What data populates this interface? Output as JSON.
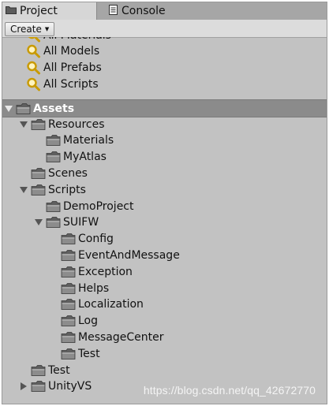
{
  "tabs": [
    {
      "label": "Project",
      "icon": "folder-icon",
      "active": true
    },
    {
      "label": "Console",
      "icon": "console-icon",
      "active": false
    }
  ],
  "toolbar": {
    "create_label": "Create"
  },
  "favorites": [
    {
      "label": "All Materials"
    },
    {
      "label": "All Models"
    },
    {
      "label": "All Prefabs"
    },
    {
      "label": "All Scripts"
    }
  ],
  "tree": [
    {
      "label": "Assets",
      "depth": 0,
      "expander": "open",
      "section": true
    },
    {
      "label": "Resources",
      "depth": 1,
      "expander": "open"
    },
    {
      "label": "Materials",
      "depth": 2,
      "expander": "none"
    },
    {
      "label": "MyAtlas",
      "depth": 2,
      "expander": "none"
    },
    {
      "label": "Scenes",
      "depth": 1,
      "expander": "none"
    },
    {
      "label": "Scripts",
      "depth": 1,
      "expander": "open"
    },
    {
      "label": "DemoProject",
      "depth": 2,
      "expander": "none"
    },
    {
      "label": "SUIFW",
      "depth": 2,
      "expander": "open"
    },
    {
      "label": "Config",
      "depth": 3,
      "expander": "none"
    },
    {
      "label": "EventAndMessage",
      "depth": 3,
      "expander": "none"
    },
    {
      "label": "Exception",
      "depth": 3,
      "expander": "none"
    },
    {
      "label": "Helps",
      "depth": 3,
      "expander": "none"
    },
    {
      "label": "Localization",
      "depth": 3,
      "expander": "none"
    },
    {
      "label": "Log",
      "depth": 3,
      "expander": "none"
    },
    {
      "label": "MessageCenter",
      "depth": 3,
      "expander": "none"
    },
    {
      "label": "Test",
      "depth": 3,
      "expander": "none"
    },
    {
      "label": "Test",
      "depth": 1,
      "expander": "none"
    },
    {
      "label": "UnityVS",
      "depth": 1,
      "expander": "closed"
    }
  ],
  "watermark": "https://blog.csdn.net/qq_42672770",
  "colors": {
    "section_bg": "#8b8b8b",
    "panel_bg": "#c2c2c2",
    "folder": "#7a7a7a",
    "search_icon": "#e0b400"
  }
}
